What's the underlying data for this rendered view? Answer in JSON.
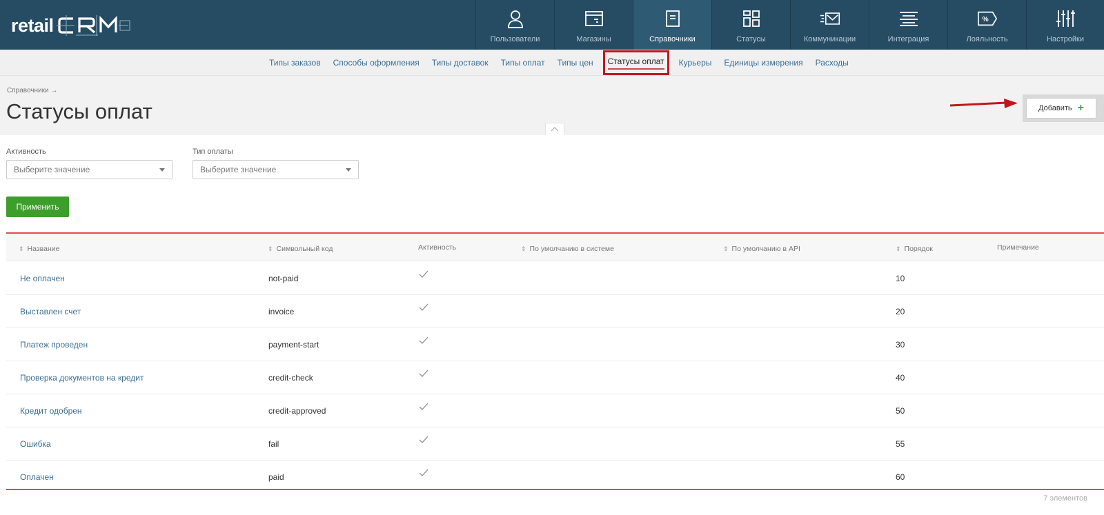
{
  "logo": {
    "text": "retail",
    "mark": "CRM"
  },
  "main_nav": [
    {
      "label": "Пользователи",
      "icon": "user-icon"
    },
    {
      "label": "Магазины",
      "icon": "store-icon"
    },
    {
      "label": "Справочники",
      "icon": "book-icon",
      "active": true
    },
    {
      "label": "Статусы",
      "icon": "statuses-icon"
    },
    {
      "label": "Коммуникации",
      "icon": "communications-icon"
    },
    {
      "label": "Интеграция",
      "icon": "integration-icon"
    },
    {
      "label": "Лояльность",
      "icon": "loyalty-icon"
    },
    {
      "label": "Настройки",
      "icon": "settings-icon"
    }
  ],
  "sub_nav": [
    {
      "label": "Типы заказов"
    },
    {
      "label": "Способы оформления"
    },
    {
      "label": "Типы доставок"
    },
    {
      "label": "Типы оплат"
    },
    {
      "label": "Типы цен"
    },
    {
      "label": "Статусы оплат",
      "active": true
    },
    {
      "label": "Курьеры"
    },
    {
      "label": "Единицы измерения"
    },
    {
      "label": "Расходы"
    }
  ],
  "breadcrumb": "Справочники →",
  "page_title": "Статусы оплат",
  "add_button": {
    "label": "Добавить",
    "icon": "plus-icon"
  },
  "filters": {
    "activity": {
      "label": "Активность",
      "placeholder": "Выберите значение"
    },
    "payment_type": {
      "label": "Тип оплаты",
      "placeholder": "Выберите значение"
    }
  },
  "apply_button": "Применить",
  "table": {
    "columns": {
      "name": "Название",
      "code": "Символьный код",
      "active": "Активность",
      "default_system": "По умолчанию в системе",
      "default_api": "По умолчанию в API",
      "order": "Порядок",
      "note": "Примечание"
    },
    "rows": [
      {
        "name": "Не оплачен",
        "code": "not-paid",
        "active": true,
        "order": "10"
      },
      {
        "name": "Выставлен счет",
        "code": "invoice",
        "active": true,
        "order": "20"
      },
      {
        "name": "Платеж проведен",
        "code": "payment-start",
        "active": true,
        "order": "30"
      },
      {
        "name": "Проверка документов на кредит",
        "code": "credit-check",
        "active": true,
        "order": "40"
      },
      {
        "name": "Кредит одобрен",
        "code": "credit-approved",
        "active": true,
        "order": "50"
      },
      {
        "name": "Ошибка",
        "code": "fail",
        "active": true,
        "order": "55"
      },
      {
        "name": "Оплачен",
        "code": "paid",
        "active": true,
        "order": "60"
      }
    ]
  },
  "total_count": "7 элементов",
  "colors": {
    "header_bg": "#264c64",
    "link": "#3a6e92",
    "apply_green": "#3d9e2c",
    "highlight_red": "#c3161c"
  }
}
